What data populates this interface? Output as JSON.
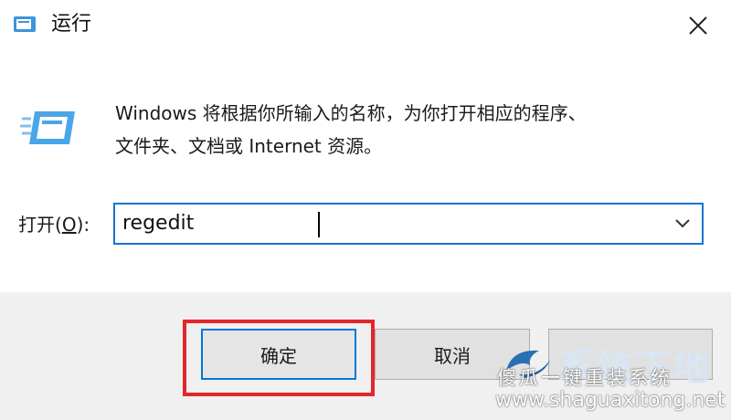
{
  "window": {
    "title": "运行",
    "close_glyph": "✕"
  },
  "dialog": {
    "description_line1": "Windows 将根据你所输入的名称，为你打开相应的程序、",
    "description_line2": "文件夹、文档或 Internet 资源。",
    "open_label_prefix": "打开(",
    "open_label_mnemonic": "O",
    "open_label_suffix": "):",
    "open_value": "regedit"
  },
  "buttons": {
    "ok_label": "确定",
    "cancel_label": "取消"
  },
  "watermark": {
    "slogan": "傻瓜一键重装系统",
    "url": "www.shaguaxitong.net",
    "big_text": "系统下地"
  },
  "icons": {
    "title": "run-icon",
    "close": "close-icon",
    "dialog": "run-icon",
    "dropdown": "chevron-down-icon",
    "watermark": "logo-icon"
  },
  "colors": {
    "accent": "#0078d7",
    "highlight": "#e4262b",
    "footer_bg": "#f0f0f0"
  }
}
